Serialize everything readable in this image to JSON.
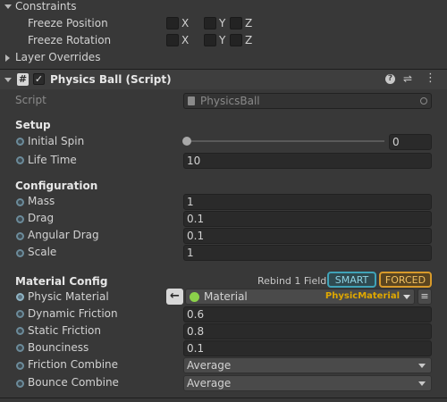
{
  "constraints": {
    "title": "Constraints",
    "freeze_position": {
      "label": "Freeze Position",
      "x": "X",
      "y": "Y",
      "z": "Z"
    },
    "freeze_rotation": {
      "label": "Freeze Rotation",
      "x": "X",
      "y": "Y",
      "z": "Z"
    }
  },
  "layer_overrides": {
    "title": "Layer Overrides"
  },
  "component": {
    "title": "Physics Ball (Script)",
    "script_label": "Script",
    "script_value": "PhysicsBall",
    "icons": [
      "help-icon",
      "presets-icon",
      "more-menu-icon"
    ]
  },
  "setup": {
    "header": "Setup",
    "initial_spin": {
      "label": "Initial Spin",
      "value": "0",
      "slider_fraction": 0
    },
    "life_time": {
      "label": "Life Time",
      "value": "10"
    }
  },
  "configuration": {
    "header": "Configuration",
    "mass": {
      "label": "Mass",
      "value": "1"
    },
    "drag": {
      "label": "Drag",
      "value": "0.1"
    },
    "angular_drag": {
      "label": "Angular Drag",
      "value": "0.1"
    },
    "scale": {
      "label": "Scale",
      "value": "1"
    }
  },
  "material_config": {
    "header": "Material Config",
    "rebind_label": "Rebind 1 Field:",
    "smart_button": "SMART",
    "forced_button": "FORCED",
    "physic_material": {
      "label": "Physic Material",
      "value": "Material",
      "type_label": "PhysicMaterial"
    },
    "dynamic_friction": {
      "label": "Dynamic Friction",
      "value": "0.6"
    },
    "static_friction": {
      "label": "Static Friction",
      "value": "0.8"
    },
    "bounciness": {
      "label": "Bounciness",
      "value": "0.1"
    },
    "friction_combine": {
      "label": "Friction Combine",
      "value": "Average"
    },
    "bounce_combine": {
      "label": "Bounce Combine",
      "value": "Average"
    }
  },
  "colors": {
    "background": "#383838",
    "header_bar": "#3e3e3e",
    "field_bg": "#2a2a2a",
    "smart_accent": "#3fa3b8",
    "forced_accent": "#d89a2a",
    "type_label": "#e0a800"
  }
}
